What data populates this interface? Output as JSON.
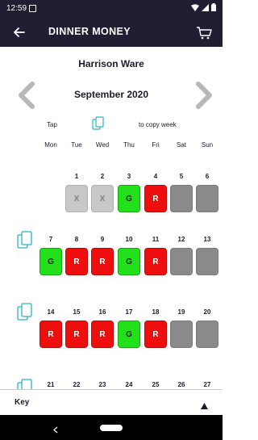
{
  "status_bar": {
    "time": "12:59"
  },
  "app_bar": {
    "title": "DINNER MONEY"
  },
  "child_name": "Harrison Ware",
  "month": "September 2020",
  "hint": {
    "tap": "Tap",
    "copy_week": "to copy week"
  },
  "weekdays": [
    "Mon",
    "Tue",
    "Wed",
    "Thu",
    "Fri",
    "Sat",
    "Sun"
  ],
  "weeks": [
    {
      "days": [
        "",
        "1",
        "2",
        "3",
        "4",
        "5",
        "6"
      ],
      "cells": [
        {
          "status": "none",
          "label": ""
        },
        {
          "status": "x",
          "label": "X"
        },
        {
          "status": "x",
          "label": "X"
        },
        {
          "status": "g",
          "label": "G"
        },
        {
          "status": "r",
          "label": "R"
        },
        {
          "status": "w",
          "label": ""
        },
        {
          "status": "w",
          "label": ""
        }
      ]
    },
    {
      "days": [
        "7",
        "8",
        "9",
        "10",
        "11",
        "12",
        "13"
      ],
      "cells": [
        {
          "status": "g",
          "label": "G"
        },
        {
          "status": "r",
          "label": "R"
        },
        {
          "status": "r",
          "label": "R"
        },
        {
          "status": "g",
          "label": "G"
        },
        {
          "status": "r",
          "label": "R"
        },
        {
          "status": "w",
          "label": ""
        },
        {
          "status": "w",
          "label": ""
        }
      ]
    },
    {
      "days": [
        "14",
        "15",
        "16",
        "17",
        "18",
        "19",
        "20"
      ],
      "cells": [
        {
          "status": "r",
          "label": "R"
        },
        {
          "status": "r",
          "label": "R"
        },
        {
          "status": "r",
          "label": "R"
        },
        {
          "status": "g",
          "label": "G"
        },
        {
          "status": "r",
          "label": "R"
        },
        {
          "status": "w",
          "label": ""
        },
        {
          "status": "w",
          "label": ""
        }
      ]
    },
    {
      "days": [
        "21",
        "22",
        "23",
        "24",
        "25",
        "26",
        "27"
      ],
      "cells": []
    }
  ],
  "key": {
    "label": "Key"
  },
  "colors": {
    "app_bar": "#1f1e33",
    "accent": "#2ab4c0",
    "green": "#22e01a",
    "red": "#ee0e0e",
    "weekend": "#8a8a8a",
    "unavailable": "#c8c8c8"
  }
}
